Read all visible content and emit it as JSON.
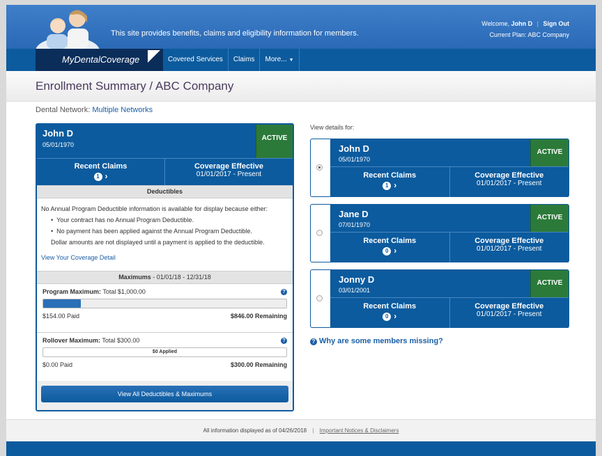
{
  "header": {
    "tagline": "This site provides benefits, claims and eligibility information for members.",
    "welcome_prefix": "Welcome,",
    "user_name": "John D",
    "sign_out": "Sign Out",
    "current_plan": "Current Plan: ABC Company"
  },
  "nav": {
    "logo": "MyDentalCoverage",
    "items": [
      "Covered Services",
      "Claims",
      "More..."
    ]
  },
  "page": {
    "title": "Enrollment Summary / ABC Company",
    "network_label": "Dental Network:",
    "network_value": "Multiple Networks"
  },
  "summary": {
    "name": "John D",
    "dob": "05/01/1970",
    "status": "ACTIVE",
    "recent_claims_label": "Recent Claims",
    "recent_claims_count": "1",
    "coverage_label": "Coverage Effective",
    "coverage_value": "01/01/2017 - Present",
    "deductibles_header": "Deductibles",
    "deductible_intro": "No Annual Program Deductible information is available for display because either:",
    "deductible_reasons": [
      "Your contract has no Annual Program Deductible.",
      "No payment has been applied against the Annual Program Deductible."
    ],
    "deductible_note": "Dollar amounts are not displayed until a payment is applied to the deductible.",
    "coverage_detail_link": "View Your Coverage Detail",
    "maximums_label": "Maximums",
    "maximums_range": "- 01/01/18 - 12/31/18",
    "program_max": {
      "label": "Program Maximum:",
      "total": "Total $1,000.00",
      "paid": "$154.00 Paid",
      "remaining": "$846.00 Remaining",
      "progress_fraction": 0.154
    },
    "rollover_max": {
      "label": "Rollover Maximum:",
      "total": "Total $300.00",
      "applied": "$0 Applied",
      "paid": "$0.00 Paid",
      "remaining": "$300.00 Remaining",
      "progress_fraction": 0
    },
    "view_all_button": "View All Deductibles & Maximums"
  },
  "members": {
    "view_details_label": "View details for:",
    "list": [
      {
        "name": "John D",
        "dob": "05/01/1970",
        "status": "ACTIVE",
        "recent_claims_label": "Recent Claims",
        "recent_claims_count": "1",
        "coverage_label": "Coverage Effective",
        "coverage_value": "01/01/2017 - Present",
        "selected": true
      },
      {
        "name": "Jane D",
        "dob": "07/01/1970",
        "status": "ACTIVE",
        "recent_claims_label": "Recent Claims",
        "recent_claims_count": "0",
        "coverage_label": "Coverage Effective",
        "coverage_value": "01/01/2017 - Present",
        "selected": false
      },
      {
        "name": "Jonny D",
        "dob": "03/01/2001",
        "status": "ACTIVE",
        "recent_claims_label": "Recent Claims",
        "recent_claims_count": "0",
        "coverage_label": "Coverage Effective",
        "coverage_value": "01/01/2017 - Present",
        "selected": false
      }
    ],
    "missing_link": "Why are some members missing?"
  },
  "footer": {
    "as_of": "All information displayed as of 04/26/2018",
    "notices_link": "Important Notices & Disclaimers"
  },
  "colors": {
    "brand_blue": "#0c5b9e",
    "active_green": "#2c7a3a",
    "logo_navy": "#0b2d5a"
  }
}
